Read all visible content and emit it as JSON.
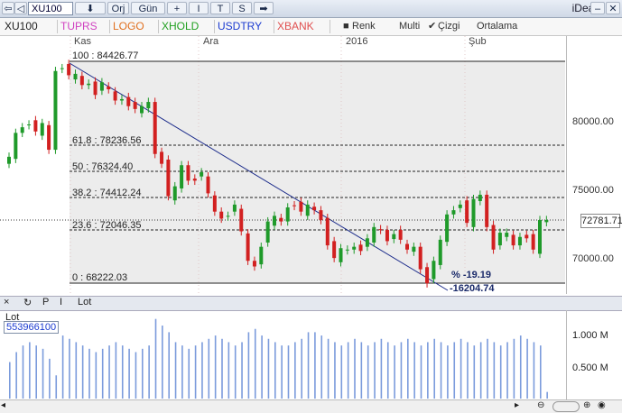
{
  "toolbar": {
    "symbol": "XU100",
    "buttons": [
      "Orj",
      "Gün",
      "+",
      "I",
      "T",
      "S"
    ],
    "brand": "iDeal"
  },
  "tabs": [
    {
      "label": "XU100",
      "color": "#000000"
    },
    {
      "label": "TUPRS",
      "color": "#d040c0"
    },
    {
      "label": "LOGO",
      "color": "#e07020"
    },
    {
      "label": "XHOLD",
      "color": "#20a020"
    },
    {
      "label": "USDTRY",
      "color": "#1a3ad0"
    },
    {
      "label": "XBANK",
      "color": "#e05050"
    }
  ],
  "controls": {
    "renk": "Renk",
    "multi": "Multi",
    "cizgi": "Çizgi",
    "ortalama": "Ortalama"
  },
  "dates": [
    "Kas",
    "Ara",
    "2016",
    "Şub"
  ],
  "y_axis_labels": [
    "80000.00",
    "75000.00",
    "70000.00"
  ],
  "fibonacci": [
    {
      "label": "100 : 84426.77"
    },
    {
      "label": "61.8 : 78236.56"
    },
    {
      "label": "50 : 76324.40"
    },
    {
      "label": "38.2 : 74412.24"
    },
    {
      "label": "23.6 : 72046.35"
    },
    {
      "label": "0 : 68222.03"
    }
  ],
  "trend": {
    "pct": "% -19.19",
    "diff": "-16204.74"
  },
  "last_price": "72781.71",
  "lower_panel": {
    "tools": [
      "×",
      "↻",
      "P",
      "I"
    ],
    "title": "Lot",
    "name": "Lot",
    "value": "553966100",
    "y_labels": [
      "1.000 M",
      "0.500 M"
    ]
  },
  "colors": {
    "up": "#1f9a2a",
    "down": "#d22020",
    "volume": "#7b9bdc",
    "trendline": "#1a2a8a"
  },
  "chart_data": {
    "type": "candlestick",
    "close_approx": [
      77300,
      79000,
      79400,
      79600,
      79100,
      79700,
      77800,
      83400,
      83600,
      83100,
      83200,
      82400,
      82500,
      81700,
      82600,
      82100,
      81300,
      81400,
      80900,
      80700,
      80900,
      81200,
      77500,
      76800,
      74500,
      75200,
      76700,
      75600,
      75600,
      76200,
      74700,
      73400,
      72900,
      73100,
      73900,
      72000,
      69900,
      69500,
      70900,
      72700,
      73100,
      72700,
      73700,
      73800,
      73400,
      73900,
      73500,
      72800,
      71000,
      70100,
      70800,
      70700,
      70900,
      70600,
      71500,
      72300,
      72100,
      71300,
      71800,
      71400,
      70700,
      70900,
      69300,
      68300,
      69900,
      71400,
      73200,
      73500,
      73900,
      72600,
      74300,
      74600,
      72300,
      70700,
      71900,
      71900,
      71000,
      71600,
      71500,
      70700,
      72800,
      72800
    ],
    "y_range": [
      67800,
      85500
    ],
    "volume_range": [
      0,
      1.25
    ],
    "volume_unit": "M",
    "volume_approx": [
      0.55,
      0.7,
      0.8,
      0.85,
      0.8,
      0.75,
      0.6,
      0.35,
      0.95,
      0.9,
      0.85,
      0.8,
      0.75,
      0.7,
      0.75,
      0.8,
      0.85,
      0.8,
      0.75,
      0.7,
      0.75,
      0.8,
      1.2,
      1.1,
      1.0,
      0.85,
      0.8,
      0.75,
      0.8,
      0.85,
      0.9,
      0.95,
      0.9,
      0.85,
      0.8,
      0.85,
      1.0,
      1.05,
      0.95,
      0.9,
      0.85,
      0.8,
      0.8,
      0.85,
      0.9,
      1.0,
      1.0,
      0.95,
      0.9,
      0.85,
      0.8,
      0.85,
      0.9,
      0.85,
      0.8,
      0.85,
      0.9,
      0.85,
      0.8,
      0.85,
      0.9,
      0.85,
      0.8,
      0.85,
      0.9,
      0.85,
      0.8,
      0.85,
      0.9,
      0.85,
      0.8,
      0.85,
      0.9,
      0.85,
      0.8,
      0.85,
      0.9,
      0.95,
      0.9,
      0.85,
      0.8,
      0.1
    ]
  }
}
